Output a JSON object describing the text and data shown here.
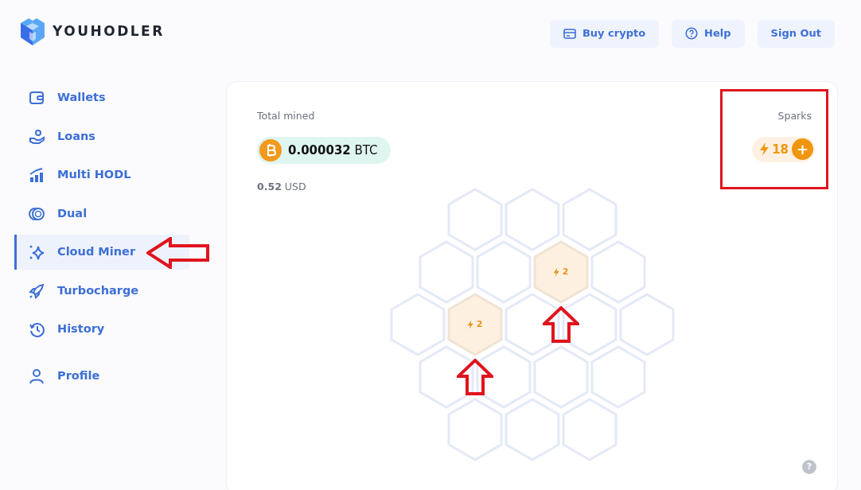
{
  "header": {
    "logo_text": "YOUHODLER",
    "buttons": [
      {
        "label": "Buy crypto",
        "kind": "card"
      },
      {
        "label": "Help",
        "kind": "help"
      },
      {
        "label": "Sign Out",
        "kind": "plain"
      }
    ]
  },
  "sidebar": {
    "items": [
      {
        "label": "Wallets",
        "selected": false,
        "annotated": false
      },
      {
        "label": "Loans",
        "selected": false,
        "annotated": false
      },
      {
        "label": "Multi HODL",
        "selected": false,
        "annotated": false
      },
      {
        "label": "Dual",
        "selected": false,
        "annotated": false
      },
      {
        "label": "Cloud Miner",
        "selected": true,
        "annotated": true
      },
      {
        "label": "Turbocharge",
        "selected": false,
        "annotated": false
      },
      {
        "label": "History",
        "selected": false,
        "annotated": false
      },
      {
        "label": "Profile",
        "selected": false,
        "annotated": false
      }
    ]
  },
  "miner": {
    "total_mined_label": "Total mined",
    "amount": "0.000032",
    "amount_unit": "BTC",
    "usd_amount": "0.52",
    "usd_unit": "USD",
    "sparks": {
      "label": "Sparks",
      "count": "18",
      "add_label": "+",
      "annotated": true
    },
    "honeycomb": [
      [
        {
          "kind": "empty"
        },
        {
          "kind": "empty"
        },
        {
          "kind": "empty"
        }
      ],
      [
        {
          "kind": "empty"
        },
        {
          "kind": "empty"
        },
        {
          "kind": "spark",
          "label": "2",
          "annotated": true
        },
        {
          "kind": "empty"
        }
      ],
      [
        {
          "kind": "empty"
        },
        {
          "kind": "spark",
          "label": "2",
          "annotated": true
        },
        {
          "kind": "empty"
        },
        {
          "kind": "empty"
        },
        {
          "kind": "empty"
        }
      ],
      [
        {
          "kind": "empty"
        },
        {
          "kind": "empty"
        },
        {
          "kind": "empty"
        },
        {
          "kind": "empty"
        }
      ],
      [
        {
          "kind": "empty"
        },
        {
          "kind": "empty"
        },
        {
          "kind": "empty"
        }
      ]
    ],
    "help_label": "?"
  }
}
